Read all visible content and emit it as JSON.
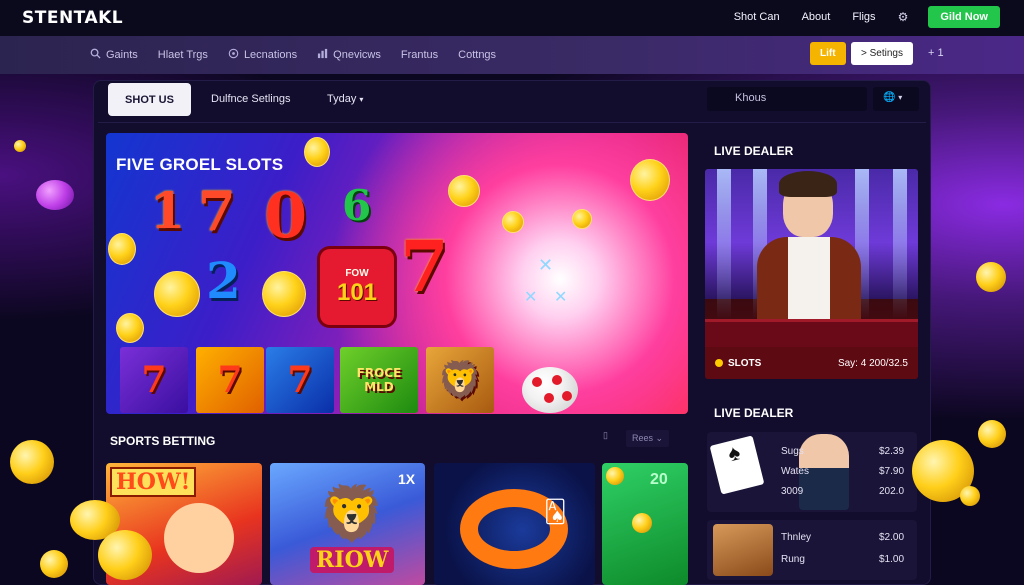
{
  "brand": {
    "logo": "STENTAKL"
  },
  "top_nav": {
    "links": [
      "Shot Can",
      "About",
      "Fligs"
    ],
    "cta": "Gild Now"
  },
  "sub_nav": {
    "items": [
      {
        "icon": "search-icon",
        "label": "Gaints"
      },
      {
        "icon": "none",
        "label": "Hlaet Trgs"
      },
      {
        "icon": "location-icon",
        "label": "Lecnations"
      },
      {
        "icon": "stats-icon",
        "label": "Qnevicws"
      },
      {
        "icon": "none",
        "label": "Frantus"
      },
      {
        "icon": "none",
        "label": "Cottngs"
      }
    ],
    "lift_label": "Lift",
    "settings_label": "Setings",
    "plus_label": "+ 1"
  },
  "content_tabs": {
    "active": "SHOT US",
    "tab2": "Dulfnce Setlings",
    "tab3": "Tyday",
    "search_value": "Khous"
  },
  "hero": {
    "title": "FIVE GROEL SLOTS",
    "numbers": [
      "1",
      "7",
      "0",
      "6",
      "2"
    ],
    "badge_top": "FOW",
    "badge_main": "101",
    "tiles": [
      "7",
      "7",
      "7",
      "FROCE MLD"
    ]
  },
  "live_dealer": {
    "title": "LIVE DEALER",
    "bar_label": "SLOTS",
    "bar_value": "Say: 4 200/32.5"
  },
  "live_dealer_2": {
    "title": "LIVE DEALER",
    "rows": [
      {
        "name": "Sugs",
        "value": "$2.39"
      },
      {
        "name": "Wates",
        "value": "$7.90"
      },
      {
        "name": "3009",
        "value": "202.0"
      }
    ],
    "rows2": [
      {
        "name": "Thnley",
        "value": "$2.00"
      },
      {
        "name": "Rung",
        "value": "$1.00"
      }
    ]
  },
  "sports": {
    "title": "SPORTS BETTING",
    "filter": "Rees",
    "tile1_badge": "HOW!",
    "tile2_badge": "RIOW",
    "tile2_mult": "1X",
    "tile4_value": "20"
  }
}
